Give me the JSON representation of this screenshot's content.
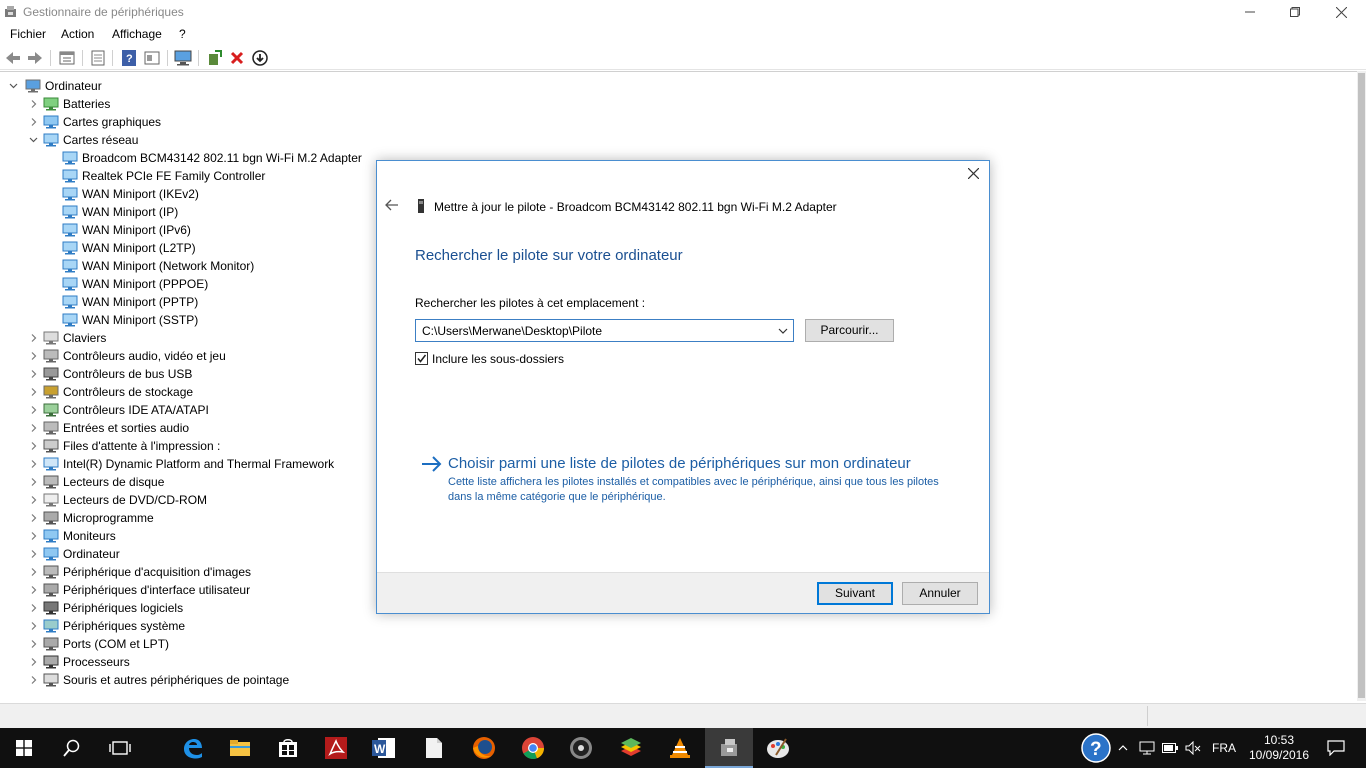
{
  "window": {
    "title": "Gestionnaire de périphériques",
    "menu": [
      "Fichier",
      "Action",
      "Affichage",
      "?"
    ]
  },
  "toolbar_icons": [
    "back-arrow-icon",
    "forward-arrow-icon",
    "properties-icon",
    "show-hide-icon",
    "help-icon",
    "view-icon",
    "scan-hardware-icon",
    "update-driver-icon",
    "uninstall-icon",
    "disable-icon"
  ],
  "tree": [
    {
      "label": "Ordinateur",
      "level": 0,
      "expanded": true,
      "icon": "computer-icon"
    },
    {
      "label": "Batteries",
      "level": 1,
      "expanded": false,
      "icon": "battery-icon"
    },
    {
      "label": "Cartes graphiques",
      "level": 1,
      "expanded": false,
      "icon": "display-adapter-icon"
    },
    {
      "label": "Cartes réseau",
      "level": 1,
      "expanded": true,
      "icon": "network-icon"
    },
    {
      "label": "Broadcom BCM43142 802.11 bgn Wi-Fi M.2 Adapter",
      "level": 2,
      "icon": "network-icon"
    },
    {
      "label": "Realtek PCIe FE Family Controller",
      "level": 2,
      "icon": "network-icon"
    },
    {
      "label": "WAN Miniport (IKEv2)",
      "level": 2,
      "icon": "network-icon"
    },
    {
      "label": "WAN Miniport (IP)",
      "level": 2,
      "icon": "network-icon"
    },
    {
      "label": "WAN Miniport (IPv6)",
      "level": 2,
      "icon": "network-icon"
    },
    {
      "label": "WAN Miniport (L2TP)",
      "level": 2,
      "icon": "network-icon"
    },
    {
      "label": "WAN Miniport (Network Monitor)",
      "level": 2,
      "icon": "network-icon"
    },
    {
      "label": "WAN Miniport (PPPOE)",
      "level": 2,
      "icon": "network-icon"
    },
    {
      "label": "WAN Miniport (PPTP)",
      "level": 2,
      "icon": "network-icon"
    },
    {
      "label": "WAN Miniport (SSTP)",
      "level": 2,
      "icon": "network-icon"
    },
    {
      "label": "Claviers",
      "level": 1,
      "expanded": false,
      "icon": "keyboard-icon"
    },
    {
      "label": "Contrôleurs audio, vidéo et jeu",
      "level": 1,
      "expanded": false,
      "icon": "audio-icon"
    },
    {
      "label": "Contrôleurs de bus USB",
      "level": 1,
      "expanded": false,
      "icon": "usb-icon"
    },
    {
      "label": "Contrôleurs de stockage",
      "level": 1,
      "expanded": false,
      "icon": "storage-icon"
    },
    {
      "label": "Contrôleurs IDE ATA/ATAPI",
      "level": 1,
      "expanded": false,
      "icon": "ide-icon"
    },
    {
      "label": "Entrées et sorties audio",
      "level": 1,
      "expanded": false,
      "icon": "audio-icon"
    },
    {
      "label": "Files d'attente à l'impression :",
      "level": 1,
      "expanded": false,
      "icon": "printer-icon"
    },
    {
      "label": "Intel(R) Dynamic Platform and Thermal Framework",
      "level": 1,
      "expanded": false,
      "icon": "chip-icon"
    },
    {
      "label": "Lecteurs de disque",
      "level": 1,
      "expanded": false,
      "icon": "disk-icon"
    },
    {
      "label": "Lecteurs de DVD/CD-ROM",
      "level": 1,
      "expanded": false,
      "icon": "dvd-icon"
    },
    {
      "label": "Microprogramme",
      "level": 1,
      "expanded": false,
      "icon": "firmware-icon"
    },
    {
      "label": "Moniteurs",
      "level": 1,
      "expanded": false,
      "icon": "monitor-icon"
    },
    {
      "label": "Ordinateur",
      "level": 1,
      "expanded": false,
      "icon": "monitor-icon"
    },
    {
      "label": "Périphérique d'acquisition d'images",
      "level": 1,
      "expanded": false,
      "icon": "camera-icon"
    },
    {
      "label": "Périphériques d'interface utilisateur",
      "level": 1,
      "expanded": false,
      "icon": "hid-icon"
    },
    {
      "label": "Périphériques logiciels",
      "level": 1,
      "expanded": false,
      "icon": "software-device-icon"
    },
    {
      "label": "Périphériques système",
      "level": 1,
      "expanded": false,
      "icon": "system-icon"
    },
    {
      "label": "Ports (COM et LPT)",
      "level": 1,
      "expanded": false,
      "icon": "port-icon"
    },
    {
      "label": "Processeurs",
      "level": 1,
      "expanded": false,
      "icon": "processor-icon"
    },
    {
      "label": "Souris et autres périphériques de pointage",
      "level": 1,
      "expanded": false,
      "icon": "mouse-icon"
    }
  ],
  "dialog": {
    "title": "Mettre à jour le pilote - Broadcom BCM43142 802.11 bgn Wi-Fi M.2 Adapter",
    "heading": "Rechercher le pilote sur votre ordinateur",
    "location_label": "Rechercher les pilotes à cet emplacement :",
    "path_value": "C:\\Users\\Merwane\\Desktop\\Pilote",
    "browse_label": "Parcourir...",
    "include_subfolders_label": "Inclure les sous-dossiers",
    "include_subfolders_checked": true,
    "choose_link_title": "Choisir parmi une liste de pilotes de périphériques sur mon ordinateur",
    "choose_link_desc": "Cette liste affichera les pilotes installés et compatibles avec le périphérique, ainsi que tous les pilotes dans la même catégorie que le périphérique.",
    "next_label": "Suivant",
    "cancel_label": "Annuler",
    "accent_color": "#1c5ea5"
  },
  "taskbar": {
    "apps": [
      "start-icon",
      "search-icon",
      "task-view-icon",
      "edge-icon",
      "file-explorer-icon",
      "store-icon",
      "acrobat-icon",
      "word-icon",
      "notepad-icon",
      "firefox-icon",
      "chrome-icon",
      "media-icon",
      "bluestacks-icon",
      "vlc-icon",
      "device-manager-icon",
      "paint-icon"
    ],
    "language": "FRA",
    "time": "10:53",
    "date": "10/09/2016"
  }
}
